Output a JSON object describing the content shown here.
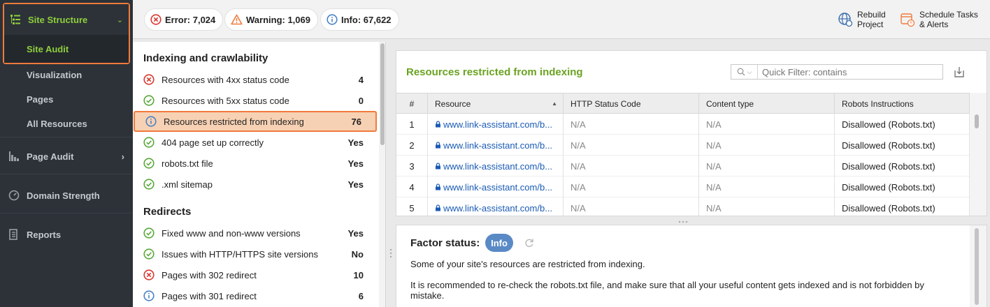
{
  "sidebar": {
    "site_structure": "Site Structure",
    "site_audit": "Site Audit",
    "visualization": "Visualization",
    "pages": "Pages",
    "all_resources": "All Resources",
    "page_audit": "Page Audit",
    "domain_strength": "Domain Strength",
    "reports": "Reports"
  },
  "topbar": {
    "error": "Error: 7,024",
    "warning": "Warning: 1,069",
    "info": "Info: 67,622",
    "rebuild_line1": "Rebuild",
    "rebuild_line2": "Project",
    "schedule_line1": "Schedule Tasks",
    "schedule_line2": "& Alerts"
  },
  "factors": {
    "section1": "Indexing and crawlability",
    "section2": "Redirects",
    "items": [
      {
        "status": "error",
        "label": "Resources with 4xx status code",
        "value": "4"
      },
      {
        "status": "ok",
        "label": "Resources with 5xx status code",
        "value": "0"
      },
      {
        "status": "info",
        "label": "Resources restricted from indexing",
        "value": "76"
      },
      {
        "status": "ok",
        "label": "404 page set up correctly",
        "value": "Yes"
      },
      {
        "status": "ok",
        "label": "robots.txt file",
        "value": "Yes"
      },
      {
        "status": "ok",
        "label": ".xml sitemap",
        "value": "Yes"
      },
      {
        "status": "ok",
        "label": "Fixed www and non-www versions",
        "value": "Yes"
      },
      {
        "status": "ok",
        "label": "Issues with HTTP/HTTPS site versions",
        "value": "No"
      },
      {
        "status": "error",
        "label": "Pages with 302 redirect",
        "value": "10"
      },
      {
        "status": "info",
        "label": "Pages with 301 redirect",
        "value": "6"
      }
    ]
  },
  "details": {
    "title": "Resources restricted from indexing",
    "filter_placeholder": "Quick Filter: contains",
    "columns": [
      "#",
      "Resource",
      "HTTP Status Code",
      "Content type",
      "Robots Instructions"
    ],
    "rows": [
      {
        "n": "1",
        "resource": "www.link-assistant.com/b...",
        "status": "N/A",
        "ctype": "N/A",
        "robots": "Disallowed (Robots.txt)"
      },
      {
        "n": "2",
        "resource": "www.link-assistant.com/b...",
        "status": "N/A",
        "ctype": "N/A",
        "robots": "Disallowed (Robots.txt)"
      },
      {
        "n": "3",
        "resource": "www.link-assistant.com/b...",
        "status": "N/A",
        "ctype": "N/A",
        "robots": "Disallowed (Robots.txt)"
      },
      {
        "n": "4",
        "resource": "www.link-assistant.com/b...",
        "status": "N/A",
        "ctype": "N/A",
        "robots": "Disallowed (Robots.txt)"
      },
      {
        "n": "5",
        "resource": "www.link-assistant.com/b...",
        "status": "N/A",
        "ctype": "N/A",
        "robots": "Disallowed (Robots.txt)"
      }
    ]
  },
  "factor_status": {
    "label": "Factor status:",
    "badge": "Info",
    "p1": "Some of your site's resources are restricted from indexing.",
    "p2_line1": "It is recommended to re-check the robots.txt file, and make sure that all your useful content gets indexed and is not forbidden by",
    "p2_line2": "mistake."
  },
  "colors": {
    "accent_green": "#8fcf3c",
    "highlight_orange": "#f07a3c",
    "info_blue": "#5a8ac6",
    "error_red": "#d9382f",
    "ok_green": "#5aa83a"
  }
}
